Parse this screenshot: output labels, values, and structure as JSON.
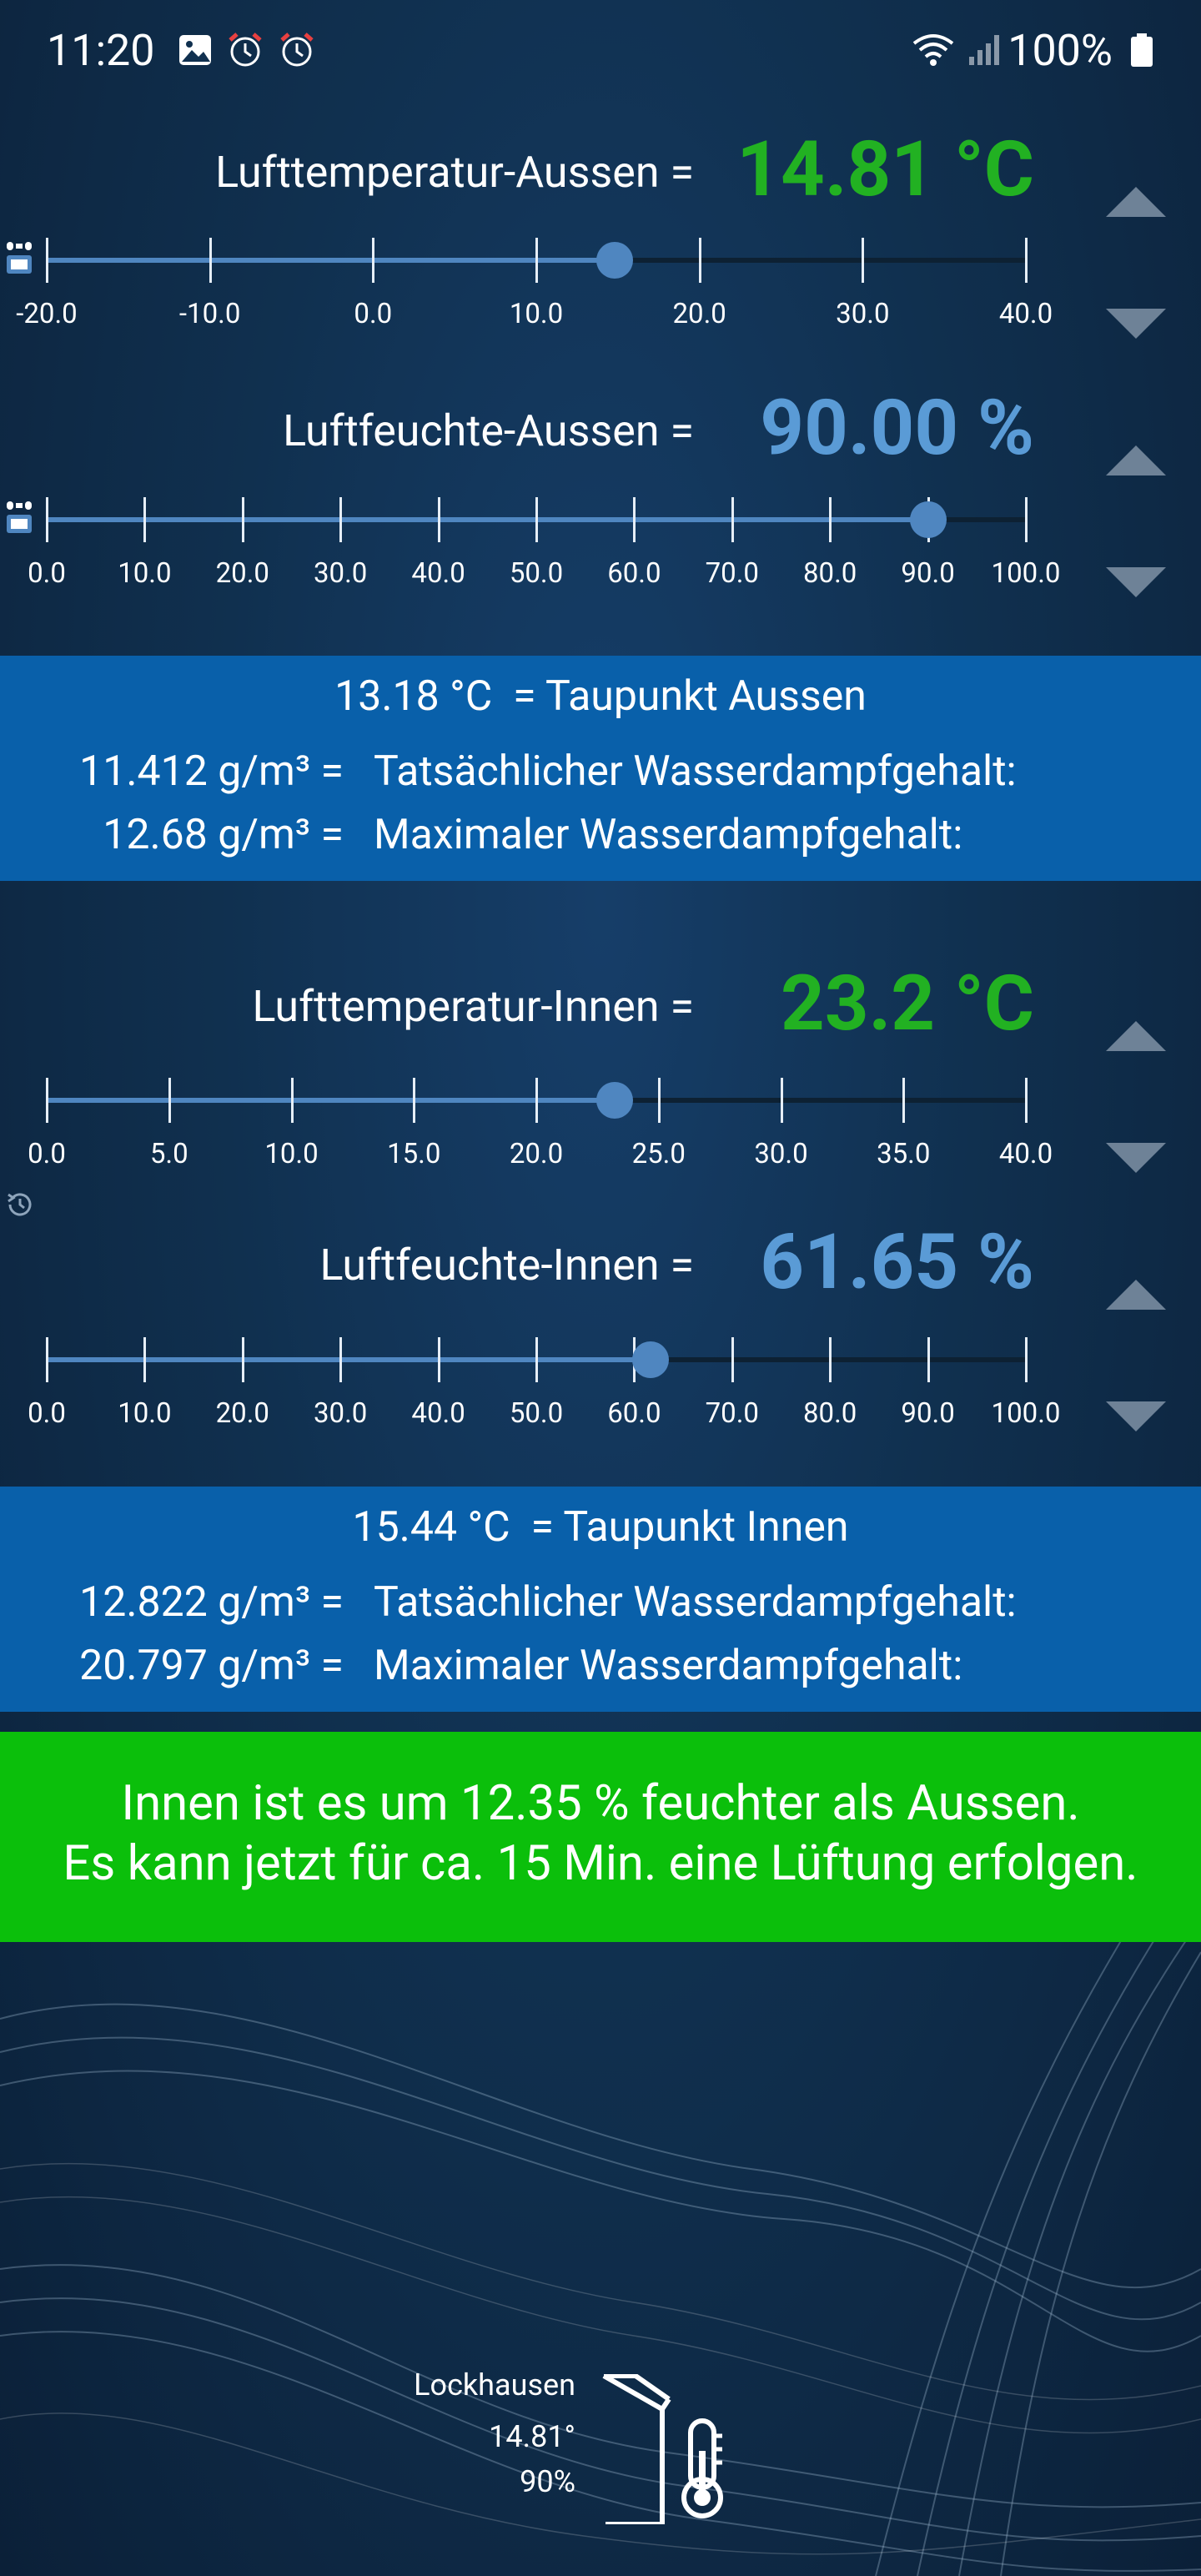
{
  "status_bar": {
    "time": "11:20",
    "battery": "100%",
    "icons": [
      "gallery-icon",
      "alarm-icon",
      "alarm-icon",
      "wifi-icon",
      "signal-icon",
      "battery-icon"
    ]
  },
  "outdoor": {
    "temperature": {
      "label": "Lufttemperatur-Aussen =",
      "value": "14.81 °C",
      "slider_value": 14.81,
      "min": -20,
      "max": 40,
      "ticks": [
        "-20.0",
        "-10.0",
        "0.0",
        "10.0",
        "20.0",
        "30.0",
        "40.0"
      ]
    },
    "humidity": {
      "label": "Luftfeuchte-Aussen =",
      "value": "90.00 %",
      "slider_value": 90,
      "min": 0,
      "max": 100,
      "ticks": [
        "0.0",
        "10.0",
        "20.0",
        "30.0",
        "40.0",
        "50.0",
        "60.0",
        "70.0",
        "80.0",
        "90.0",
        "100.0"
      ]
    },
    "panel": {
      "dewpoint_value": "13.18 °C",
      "dewpoint_label": "= Taupunkt Aussen",
      "actual_value": "11.412 g/m³ =",
      "actual_label": "Tatsächlicher Wasserdampfgehalt:",
      "max_value": "12.68 g/m³ =",
      "max_label": "Maximaler Wasserdampfgehalt:"
    }
  },
  "indoor": {
    "temperature": {
      "label": "Lufttemperatur-Innen =",
      "value": "23.2 °C",
      "slider_value": 23.2,
      "min": 0,
      "max": 40,
      "ticks": [
        "0.0",
        "5.0",
        "10.0",
        "15.0",
        "20.0",
        "25.0",
        "30.0",
        "35.0",
        "40.0"
      ]
    },
    "humidity": {
      "label": "Luftfeuchte-Innen =",
      "value": "61.65 %",
      "slider_value": 61.65,
      "min": 0,
      "max": 100,
      "ticks": [
        "0.0",
        "10.0",
        "20.0",
        "30.0",
        "40.0",
        "50.0",
        "60.0",
        "70.0",
        "80.0",
        "90.0",
        "100.0"
      ]
    },
    "panel": {
      "dewpoint_value": "15.44 °C",
      "dewpoint_label": "= Taupunkt Innen",
      "actual_value": "12.822 g/m³ =",
      "actual_label": "Tatsächlicher Wasserdampfgehalt:",
      "max_value": "20.797 g/m³ =",
      "max_label": "Maximaler Wasserdampfgehalt:"
    }
  },
  "recommendation": {
    "line1": "Innen ist es um 12.35 % feuchter als Aussen.",
    "line2": "Es kann jetzt für ca. 15 Min. eine Lüftung erfolgen."
  },
  "widget": {
    "location": "Lockhausen",
    "temperature": "14.81°",
    "humidity": "90%"
  },
  "colors": {
    "temp_value": "#22b122",
    "humidity_value": "#5a9bd6",
    "panel_bg": "#0960aa",
    "recommendation_bg": "#0bbf0b"
  }
}
